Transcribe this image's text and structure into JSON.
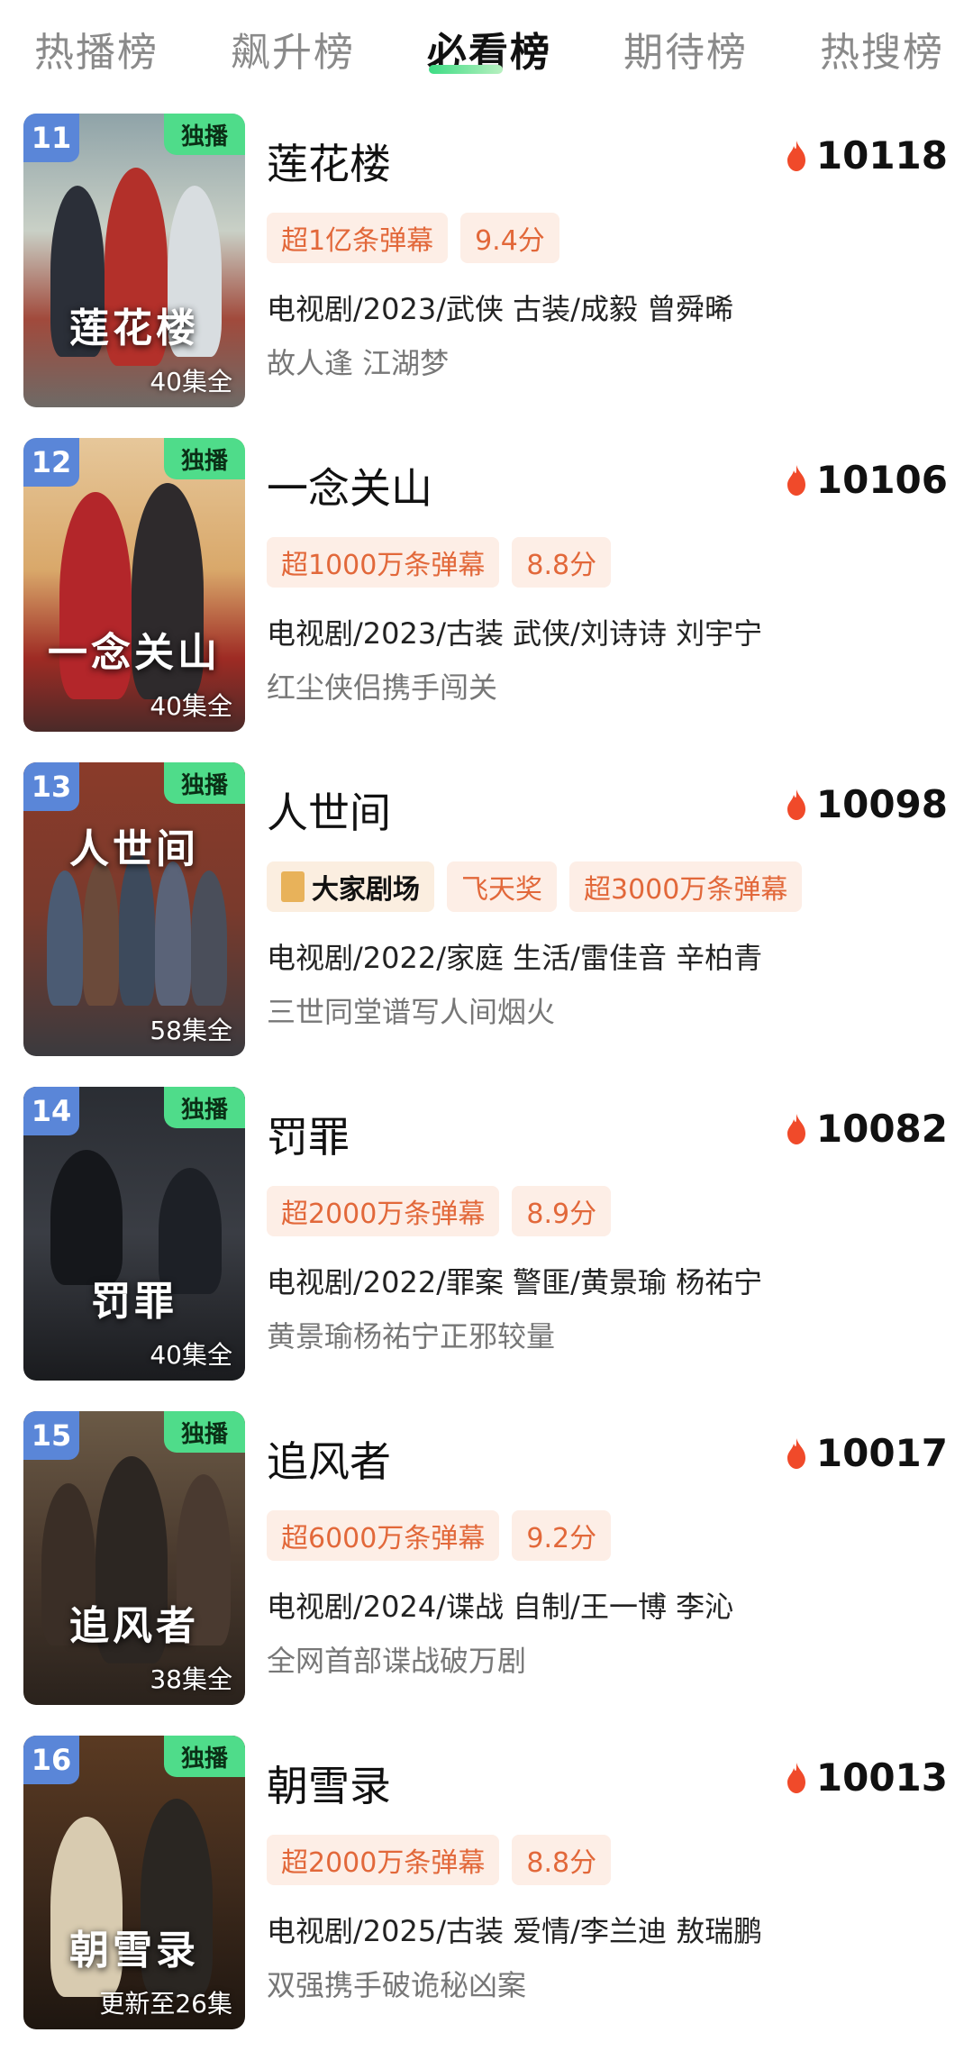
{
  "tabs": [
    "热播榜",
    "飙升榜",
    "必看榜",
    "期待榜",
    "热搜榜"
  ],
  "active_tab": 2,
  "items": [
    {
      "rank": "11",
      "badge": "独播",
      "episodes": "40集全",
      "poster_text": "莲花楼",
      "title": "莲花楼",
      "heat": "10118",
      "tags": [
        "超1亿条弹幕",
        "9.4分"
      ],
      "meta": "电视剧/2023/武侠 古装/成毅 曾舜晞",
      "desc": "故人逢 江湖梦"
    },
    {
      "rank": "12",
      "badge": "独播",
      "episodes": "40集全",
      "poster_text": "一念关山",
      "title": "一念关山",
      "heat": "10106",
      "tags": [
        "超1000万条弹幕",
        "8.8分"
      ],
      "meta": "电视剧/2023/古装 武侠/刘诗诗 刘宇宁",
      "desc": "红尘侠侣携手闯关"
    },
    {
      "rank": "13",
      "badge": "独播",
      "episodes": "58集全",
      "poster_text": "人世间",
      "title": "人世间",
      "heat": "10098",
      "brand_tag": "大家剧场",
      "tags": [
        "飞天奖",
        "超3000万条弹幕"
      ],
      "meta": "电视剧/2022/家庭 生活/雷佳音 辛柏青",
      "desc": "三世同堂谱写人间烟火"
    },
    {
      "rank": "14",
      "badge": "独播",
      "episodes": "40集全",
      "poster_text": "罚罪",
      "title": "罚罪",
      "heat": "10082",
      "tags": [
        "超2000万条弹幕",
        "8.9分"
      ],
      "meta": "电视剧/2022/罪案 警匪/黄景瑜 杨祐宁",
      "desc": "黄景瑜杨祐宁正邪较量"
    },
    {
      "rank": "15",
      "badge": "独播",
      "episodes": "38集全",
      "poster_text": "追风者",
      "title": "追风者",
      "heat": "10017",
      "tags": [
        "超6000万条弹幕",
        "9.2分"
      ],
      "meta": "电视剧/2024/谍战 自制/王一博 李沁",
      "desc": "全网首部谍战破万剧"
    },
    {
      "rank": "16",
      "badge": "独播",
      "episodes": "更新至26集",
      "poster_text": "朝雪录",
      "title": "朝雪录",
      "heat": "10013",
      "tags": [
        "超2000万条弹幕",
        "8.8分"
      ],
      "meta": "电视剧/2025/古装 爱情/李兰迪 敖瑞鹏",
      "desc": "双强携手破诡秘凶案"
    }
  ],
  "colors": {
    "accent_green": "#4fdc8a",
    "rank_blue": "#5a86d8",
    "tag_orange": "#e2683a",
    "tag_bg": "#fdeee6",
    "flame": "#f04a2a"
  }
}
